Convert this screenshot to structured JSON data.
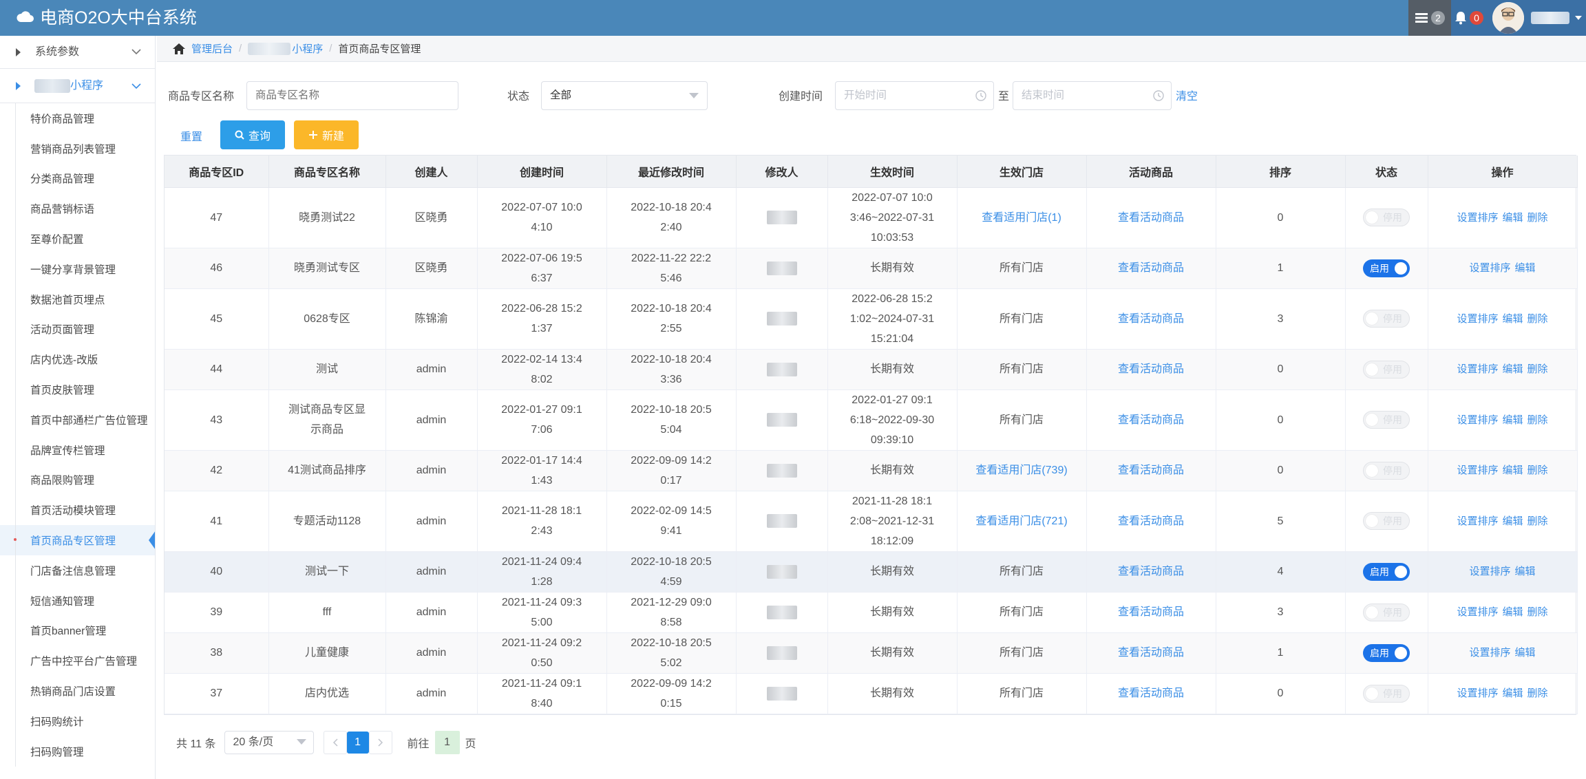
{
  "app": {
    "title": "电商O2O大中台系统",
    "task_badge": "2",
    "bell_badge": "0"
  },
  "colors": {
    "header": "#4a87b9",
    "accent": "#3a8ee6",
    "primary_btn": "#2d9ee8",
    "warn_btn": "#fbb729",
    "switch_on": "#1c73e8"
  },
  "sidebar": {
    "group_system": "系统参数",
    "group_mini": "小程序",
    "items": [
      "特价商品管理",
      "营销商品列表管理",
      "分类商品管理",
      "商品营销标语",
      "至尊价配置",
      "一键分享背景管理",
      "数据池首页埋点",
      "活动页面管理",
      "店内优选-改版",
      "首页皮肤管理",
      "首页中部通栏广告位管理",
      "品牌宣传栏管理",
      "商品限购管理",
      "首页活动模块管理",
      "首页商品专区管理",
      "门店备注信息管理",
      "短信通知管理",
      "首页banner管理",
      "广告中控平台广告管理",
      "热销商品门店设置",
      "扫码购统计",
      "扫码购管理"
    ]
  },
  "breadcrumb": {
    "home": "管理后台",
    "mini": "小程序",
    "current": "首页商品专区管理"
  },
  "filters": {
    "name_label": "商品专区名称",
    "name_placeholder": "商品专区名称",
    "status_label": "状态",
    "status_value": "全部",
    "time_label": "创建时间",
    "start_placeholder": "开始时间",
    "to": "至",
    "end_placeholder": "结束时间",
    "clear": "清空"
  },
  "actions": {
    "reset": "重置",
    "query": "查询",
    "new": "新建"
  },
  "table": {
    "headers": [
      "商品专区ID",
      "商品专区名称",
      "创建人",
      "创建时间",
      "最近修改时间",
      "修改人",
      "生效时间",
      "生效门店",
      "活动商品",
      "排序",
      "状态",
      "操作"
    ],
    "op_sort": "设置排序",
    "op_edit": "编辑",
    "op_delete": "删除",
    "switch_on": "启用",
    "switch_off": "停用",
    "rows": [
      {
        "id": "47",
        "name": "晓勇测试22",
        "creator": "区晓勇",
        "created": "2022-07-07 10:0\n4:10",
        "modified": "2022-10-18 20:4\n2:40",
        "effective": "2022-07-07 10:0\n3:46~2022-07-31\n10:03:53",
        "store": "查看适用门店(1)",
        "store_link": true,
        "goods": "查看活动商品",
        "sort": "0",
        "enabled": false,
        "del": true,
        "tall": true
      },
      {
        "id": "46",
        "name": "晓勇测试专区",
        "creator": "区晓勇",
        "created": "2022-07-06 19:5\n6:37",
        "modified": "2022-11-22 22:2\n5:46",
        "effective": "长期有效",
        "store": "所有门店",
        "store_link": false,
        "goods": "查看活动商品",
        "sort": "1",
        "enabled": true,
        "del": false,
        "tall": false
      },
      {
        "id": "45",
        "name": "0628专区",
        "creator": "陈锦渝",
        "created": "2022-06-28 15:2\n1:37",
        "modified": "2022-10-18 20:4\n2:55",
        "effective": "2022-06-28 15:2\n1:02~2024-07-31\n15:21:04",
        "store": "所有门店",
        "store_link": false,
        "goods": "查看活动商品",
        "sort": "3",
        "enabled": false,
        "del": true,
        "tall": true
      },
      {
        "id": "44",
        "name": "测试",
        "creator": "admin",
        "created": "2022-02-14 13:4\n8:02",
        "modified": "2022-10-18 20:4\n3:36",
        "effective": "长期有效",
        "store": "所有门店",
        "store_link": false,
        "goods": "查看活动商品",
        "sort": "0",
        "enabled": false,
        "del": true,
        "tall": false
      },
      {
        "id": "43",
        "name": "测试商品专区显\n示商品",
        "creator": "admin",
        "created": "2022-01-27 09:1\n7:06",
        "modified": "2022-10-18 20:5\n5:04",
        "effective": "2022-01-27 09:1\n6:18~2022-09-30\n09:39:10",
        "store": "所有门店",
        "store_link": false,
        "goods": "查看活动商品",
        "sort": "0",
        "enabled": false,
        "del": true,
        "tall": true
      },
      {
        "id": "42",
        "name": "41测试商品排序",
        "creator": "admin",
        "created": "2022-01-17 14:4\n1:43",
        "modified": "2022-09-09 14:2\n0:17",
        "effective": "长期有效",
        "store": "查看适用门店(739)",
        "store_link": true,
        "goods": "查看活动商品",
        "sort": "0",
        "enabled": false,
        "del": true,
        "tall": false
      },
      {
        "id": "41",
        "name": "专题活动1128",
        "creator": "admin",
        "created": "2021-11-28 18:1\n2:43",
        "modified": "2022-02-09 14:5\n9:41",
        "effective": "2021-11-28 18:1\n2:08~2021-12-31\n18:12:09",
        "store": "查看适用门店(721)",
        "store_link": true,
        "goods": "查看活动商品",
        "sort": "5",
        "enabled": false,
        "del": true,
        "tall": true
      },
      {
        "id": "40",
        "name": "测试一下",
        "creator": "admin",
        "created": "2021-11-24 09:4\n1:28",
        "modified": "2022-10-18 20:5\n4:59",
        "effective": "长期有效",
        "store": "所有门店",
        "store_link": false,
        "goods": "查看活动商品",
        "sort": "4",
        "enabled": true,
        "del": false,
        "tall": false
      },
      {
        "id": "39",
        "name": "fff",
        "creator": "admin",
        "created": "2021-11-24 09:3\n5:00",
        "modified": "2021-12-29 09:0\n8:58",
        "effective": "长期有效",
        "store": "所有门店",
        "store_link": false,
        "goods": "查看活动商品",
        "sort": "3",
        "enabled": false,
        "del": true,
        "tall": false
      },
      {
        "id": "38",
        "name": "儿童健康",
        "creator": "admin",
        "created": "2021-11-24 09:2\n0:50",
        "modified": "2022-10-18 20:5\n5:02",
        "effective": "长期有效",
        "store": "所有门店",
        "store_link": false,
        "goods": "查看活动商品",
        "sort": "1",
        "enabled": true,
        "del": false,
        "tall": false
      },
      {
        "id": "37",
        "name": "店内优选",
        "creator": "admin",
        "created": "2021-11-24 09:1\n8:40",
        "modified": "2022-09-09 14:2\n0:15",
        "effective": "长期有效",
        "store": "所有门店",
        "store_link": false,
        "goods": "查看活动商品",
        "sort": "0",
        "enabled": false,
        "del": true,
        "tall": false
      }
    ]
  },
  "pagination": {
    "total": "共 11 条",
    "page_size": "20 条/页",
    "current_page": "1",
    "goto_label": "前往",
    "goto_value": "1",
    "page_suffix": "页"
  }
}
